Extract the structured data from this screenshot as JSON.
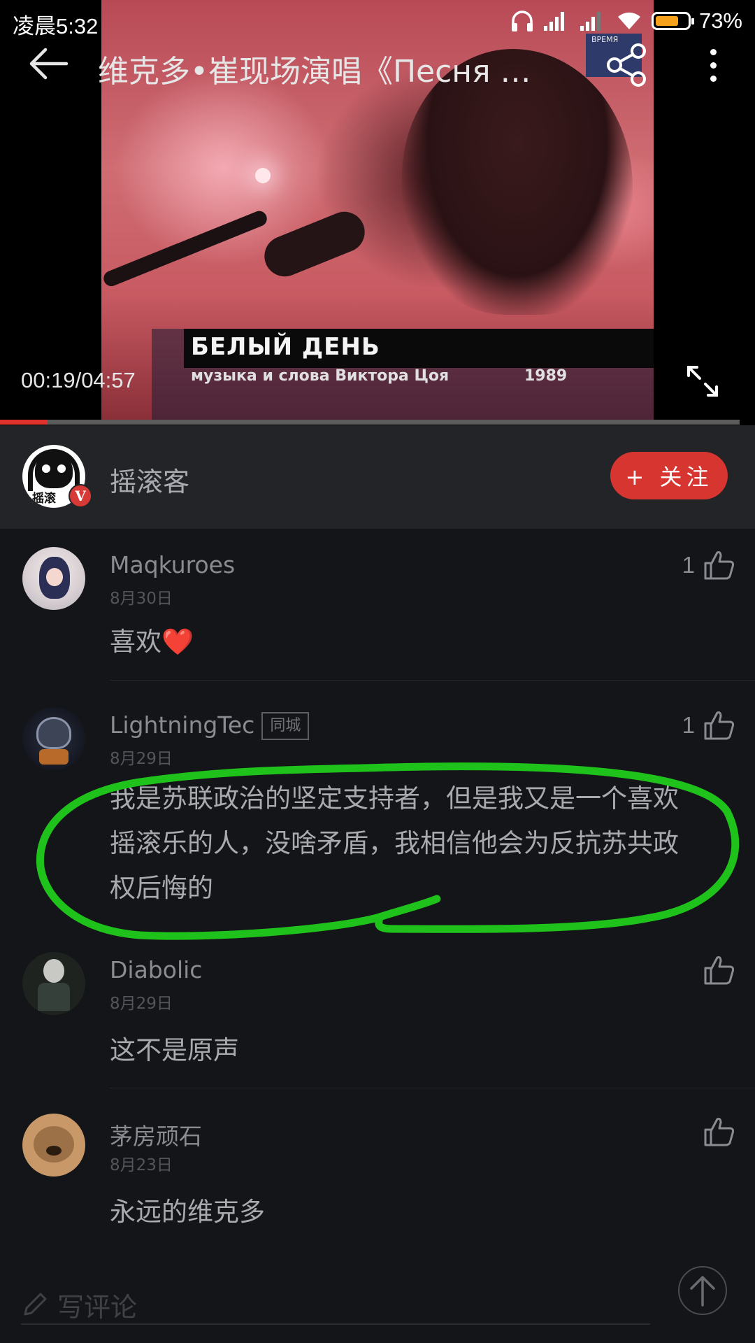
{
  "status_bar": {
    "time": "凌晨5:32",
    "battery": "73%",
    "battery_level": 0.73
  },
  "video": {
    "title": "维克多•崔现场演唱《Песня Б...",
    "current_time": "00:19/04:57",
    "progress": 0.064,
    "caption_title": "БЕЛЫЙ ДЕНЬ",
    "caption_subtitle": "музыка и слова Виктора Цоя",
    "caption_year": "1989",
    "channel_logo_text": "ВРЕМЯ"
  },
  "publisher": {
    "name": "摇滚客",
    "verified_badge": "V",
    "avatar_text": "摇滚",
    "follow_label": "+ 关注"
  },
  "comments": [
    {
      "name": "Maqkuroes",
      "date": "8月30日",
      "text": "喜欢❤️",
      "likes": "1",
      "badge": ""
    },
    {
      "name": "LightningTec",
      "date": "8月29日",
      "text": "我是苏联政治的坚定支持者，但是我又是一个喜欢摇滚乐的人，没啥矛盾，我相信他会为反抗苏共政权后悔的",
      "likes": "1",
      "badge": "同城"
    },
    {
      "name": "Diabolic",
      "date": "8月29日",
      "text": "这不是原声",
      "likes": "",
      "badge": ""
    },
    {
      "name": "茅房顽石",
      "date": "8月23日",
      "text": "永远的维克多",
      "likes": "",
      "badge": ""
    }
  ],
  "bottom": {
    "comment_placeholder": "写评论"
  },
  "colors": {
    "accent": "#d63530",
    "annotation": "#1fc21b",
    "background": "#141518"
  },
  "icons": [
    "back-arrow-icon",
    "share-icon",
    "more-icon",
    "fullscreen-icon",
    "thumbs-up-icon",
    "pencil-icon",
    "arrow-up-icon",
    "headphone-icon",
    "signal-icon",
    "wifi-icon",
    "battery-icon"
  ]
}
